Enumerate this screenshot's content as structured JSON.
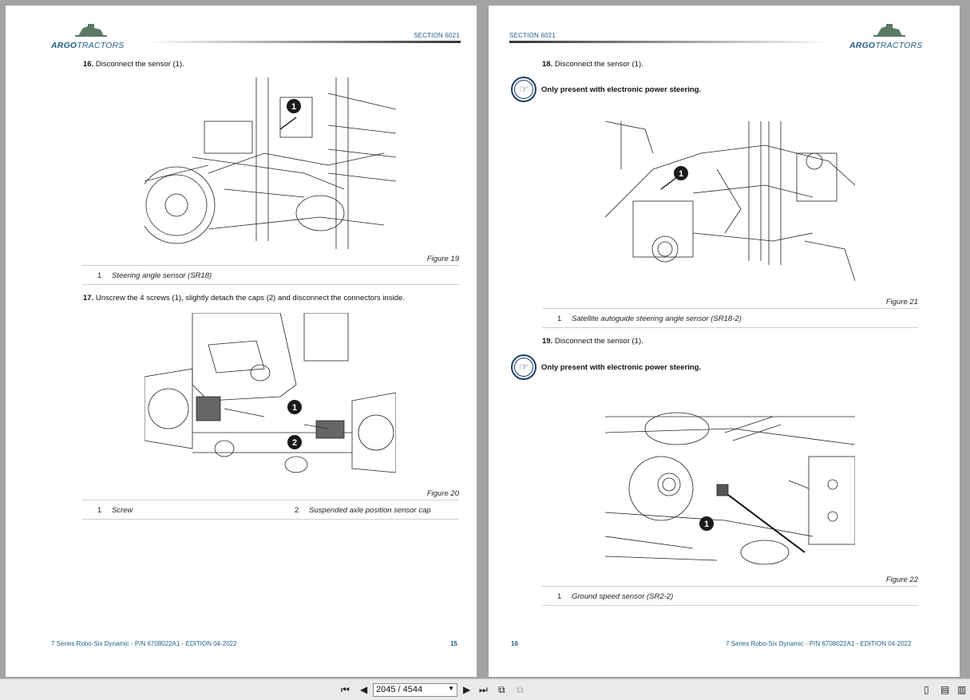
{
  "document": {
    "brand_main": "ARGO",
    "brand_sub": "TRACTORS",
    "section": "SECTION 6021",
    "footer_text": "7 Series Robo-Six Dynamic - P/N 6708022A1 - EDITION 04-2022"
  },
  "left_page": {
    "page_number": "15",
    "step16": {
      "num": "16.",
      "text": "Disconnect the sensor (1)."
    },
    "figure19": {
      "caption": "Figure 19",
      "callouts": [
        "1"
      ],
      "legend": [
        {
          "num": "1",
          "text": "Steering angle sensor (SR18)"
        }
      ]
    },
    "step17": {
      "num": "17.",
      "text": "Unscrew the 4 screws (1), slightly detach the caps (2) and disconnect the connectors inside."
    },
    "figure20": {
      "caption": "Figure 20",
      "callouts": [
        "1",
        "2"
      ],
      "legend": [
        {
          "num": "1",
          "text": "Screw"
        },
        {
          "num": "2",
          "text": "Suspended axle position sensor cap"
        }
      ]
    }
  },
  "right_page": {
    "page_number": "16",
    "step18": {
      "num": "18.",
      "text": "Disconnect the sensor (1)."
    },
    "note1": {
      "icon": "pointing-hand-icon",
      "text": "Only present with electronic power steering."
    },
    "figure21": {
      "caption": "Figure 21",
      "callouts": [
        "1"
      ],
      "legend": [
        {
          "num": "1",
          "text": "Satellite autoguide steering angle sensor (SR18-2)"
        }
      ]
    },
    "step19": {
      "num": "19.",
      "text": "Disconnect the sensor (1)."
    },
    "note2": {
      "icon": "pointing-hand-icon",
      "text": "Only present with electronic power steering."
    },
    "figure22": {
      "caption": "Figure 22",
      "callouts": [
        "1"
      ],
      "legend": [
        {
          "num": "1",
          "text": "Ground speed sensor (SR2-2)"
        }
      ]
    }
  },
  "toolbar": {
    "page_indicator": "2045 / 4544",
    "icons": [
      "first-page-icon",
      "prev-page-icon",
      "next-page-icon",
      "last-page-icon",
      "rotate-icon",
      "extract-icon",
      "single-page-view-icon",
      "continuous-view-icon",
      "two-page-view-icon"
    ]
  },
  "colors": {
    "brand": "#1f5e8a",
    "note_ring": "#1f3f6a"
  }
}
